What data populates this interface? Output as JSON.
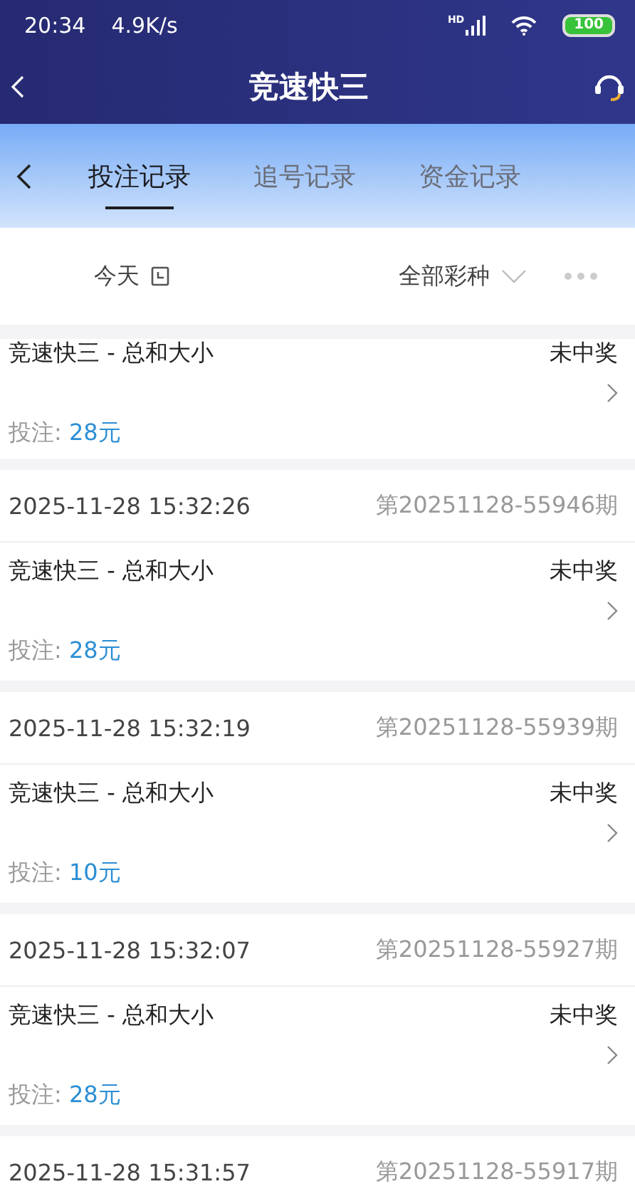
{
  "status_bar": {
    "time": "20:34",
    "speed": "4.9K/s",
    "network": "HD",
    "battery": "100"
  },
  "header": {
    "title": "竞速快三"
  },
  "tabs": [
    {
      "label": "投注记录",
      "selected": true
    },
    {
      "label": "追号记录",
      "selected": false
    },
    {
      "label": "资金记录",
      "selected": false
    }
  ],
  "filter": {
    "date": "今天",
    "lottery": "全部彩种"
  },
  "records": [
    {
      "game": "竞速快三 - 总和大小",
      "result": "未中奖",
      "bet_label": "投注:",
      "amount": "28元"
    },
    {
      "time": "2025-11-28 15:32:26",
      "issue": "第20251128-55946期",
      "game": "竞速快三 - 总和大小",
      "result": "未中奖",
      "bet_label": "投注:",
      "amount": "28元"
    },
    {
      "time": "2025-11-28 15:32:19",
      "issue": "第20251128-55939期",
      "game": "竞速快三 - 总和大小",
      "result": "未中奖",
      "bet_label": "投注:",
      "amount": "10元"
    },
    {
      "time": "2025-11-28 15:32:07",
      "issue": "第20251128-55927期",
      "game": "竞速快三 - 总和大小",
      "result": "未中奖",
      "bet_label": "投注:",
      "amount": "28元"
    },
    {
      "time": "2025-11-28 15:31:57",
      "issue": "第20251128-55917期"
    }
  ]
}
